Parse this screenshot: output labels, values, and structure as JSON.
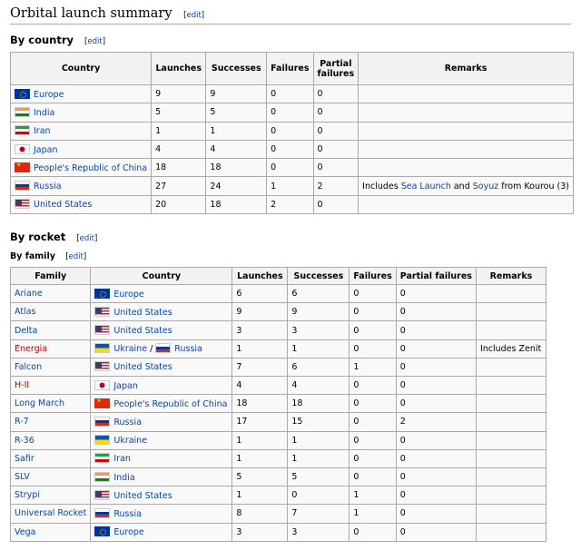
{
  "page": {
    "title": "Orbital launch summary",
    "edit_label": "edit",
    "by_country_title": "By country",
    "by_rocket_title": "By rocket",
    "by_family_title": "By family"
  },
  "country_table": {
    "headers": [
      "Country",
      "Launches",
      "Successes",
      "Failures",
      "Partial failures",
      "Remarks"
    ],
    "rows": [
      {
        "flag": "eu",
        "country": "Europe",
        "launches": "9",
        "successes": "9",
        "failures": "0",
        "partial": "0"
      },
      {
        "flag": "in",
        "country": "India",
        "launches": "5",
        "successes": "5",
        "failures": "0",
        "partial": "0"
      },
      {
        "flag": "ir",
        "country": "Iran",
        "launches": "1",
        "successes": "1",
        "failures": "0",
        "partial": "0"
      },
      {
        "flag": "jp",
        "country": "Japan",
        "launches": "4",
        "successes": "4",
        "failures": "0",
        "partial": "0"
      },
      {
        "flag": "cn",
        "country": "People's Republic of China",
        "launches": "18",
        "successes": "18",
        "failures": "0",
        "partial": "0"
      },
      {
        "flag": "ru",
        "country": "Russia",
        "launches": "27",
        "successes": "24",
        "failures": "1",
        "partial": "2",
        "remarks": {
          "prefix": "Includes ",
          "link1": "Sea Launch",
          "mid": " and ",
          "link2": "Soyuz",
          "suffix": " from Kourou (3)"
        }
      },
      {
        "flag": "us",
        "country": "United States",
        "launches": "20",
        "successes": "18",
        "failures": "2",
        "partial": "0"
      }
    ]
  },
  "family_table": {
    "headers": [
      "Family",
      "Country",
      "Launches",
      "Successes",
      "Failures",
      "Partial failures",
      "Remarks"
    ],
    "rows": [
      {
        "family": "Ariane",
        "flag": "eu",
        "country": "Europe",
        "launches": "6",
        "successes": "6",
        "failures": "0",
        "partial": "0",
        "remarks": ""
      },
      {
        "family": "Atlas",
        "flag": "us",
        "country": "United States",
        "launches": "9",
        "successes": "9",
        "failures": "0",
        "partial": "0",
        "remarks": ""
      },
      {
        "family": "Delta",
        "flag": "us",
        "country": "United States",
        "launches": "3",
        "successes": "3",
        "failures": "0",
        "partial": "0",
        "remarks": ""
      },
      {
        "family": "Energia",
        "family_red": true,
        "flag": "ua",
        "country": "Ukraine",
        "sep": " / ",
        "flag2": "ru",
        "country2": "Russia",
        "launches": "1",
        "successes": "1",
        "failures": "0",
        "partial": "0",
        "remarks": "Includes Zenit"
      },
      {
        "family": "Falcon",
        "flag": "us",
        "country": "United States",
        "launches": "7",
        "successes": "6",
        "failures": "1",
        "partial": "0",
        "remarks": ""
      },
      {
        "family": "H-II",
        "family_red": true,
        "flag": "jp",
        "country": "Japan",
        "launches": "4",
        "successes": "4",
        "failures": "0",
        "partial": "0",
        "remarks": ""
      },
      {
        "family": "Long March",
        "flag": "cn",
        "country": "People's Republic of China",
        "launches": "18",
        "successes": "18",
        "failures": "0",
        "partial": "0",
        "remarks": ""
      },
      {
        "family": "R-7",
        "flag": "ru",
        "country": "Russia",
        "launches": "17",
        "successes": "15",
        "failures": "0",
        "partial": "2",
        "remarks": ""
      },
      {
        "family": "R-36",
        "flag": "ua",
        "country": "Ukraine",
        "launches": "1",
        "successes": "1",
        "failures": "0",
        "partial": "0",
        "remarks": ""
      },
      {
        "family": "Safir",
        "flag": "ir",
        "country": "Iran",
        "launches": "1",
        "successes": "1",
        "failures": "0",
        "partial": "0",
        "remarks": ""
      },
      {
        "family": "SLV",
        "flag": "in",
        "country": "India",
        "launches": "5",
        "successes": "5",
        "failures": "0",
        "partial": "0",
        "remarks": ""
      },
      {
        "family": "Strypi",
        "flag": "us",
        "country": "United States",
        "launches": "1",
        "successes": "0",
        "failures": "1",
        "partial": "0",
        "remarks": ""
      },
      {
        "family": "Universal Rocket",
        "flag": "ru",
        "country": "Russia",
        "launches": "8",
        "successes": "7",
        "failures": "1",
        "partial": "0",
        "remarks": ""
      },
      {
        "family": "Vega",
        "flag": "eu",
        "country": "Europe",
        "launches": "3",
        "successes": "3",
        "failures": "0",
        "partial": "0",
        "remarks": ""
      }
    ]
  }
}
